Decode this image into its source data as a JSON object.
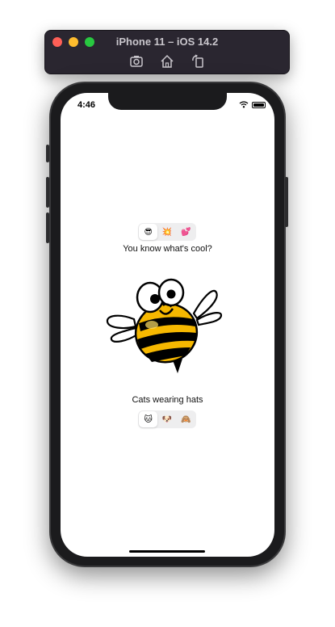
{
  "simulator": {
    "title": "iPhone 11 – iOS 14.2",
    "tools": [
      "screenshot-icon",
      "home-icon",
      "rotate-icon"
    ]
  },
  "status_bar": {
    "time": "4:46"
  },
  "top_picker": {
    "options": [
      "😎",
      "💥",
      "💕"
    ],
    "selected_index": 0
  },
  "top_caption": "You know what's cool?",
  "illustration": "bee-icon",
  "bottom_caption": "Cats wearing hats",
  "bottom_picker": {
    "options": [
      "🐱",
      "🐶",
      "🙈"
    ],
    "selected_index": 0
  }
}
